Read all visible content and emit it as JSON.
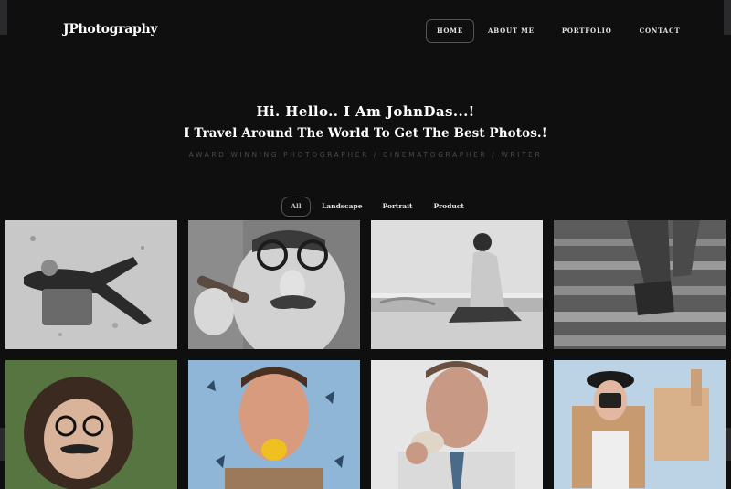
{
  "brand": {
    "logo": "JPhotography"
  },
  "nav": {
    "items": [
      {
        "label": "HOME",
        "active": true
      },
      {
        "label": "ABOUT ME",
        "active": false
      },
      {
        "label": "PORTFOLIO",
        "active": false
      },
      {
        "label": "CONTACT",
        "active": false
      }
    ]
  },
  "hero": {
    "greeting": "Hi. Hello.. I Am JohnDas...!",
    "tagline": "I Travel Around The World To Get The Best Photos.!",
    "subtitle": "AWARD WINNING PHOTOGRAPHER / CINEMATOGRAPHER / WRITER"
  },
  "filters": {
    "items": [
      {
        "label": "All",
        "active": true
      },
      {
        "label": "Landscape",
        "active": false
      },
      {
        "label": "Portrait",
        "active": false
      },
      {
        "label": "Product",
        "active": false
      }
    ]
  },
  "colors": {
    "background": "#0f0f10",
    "accent_border": "#555555",
    "subtitle": "#4a4a4c"
  }
}
